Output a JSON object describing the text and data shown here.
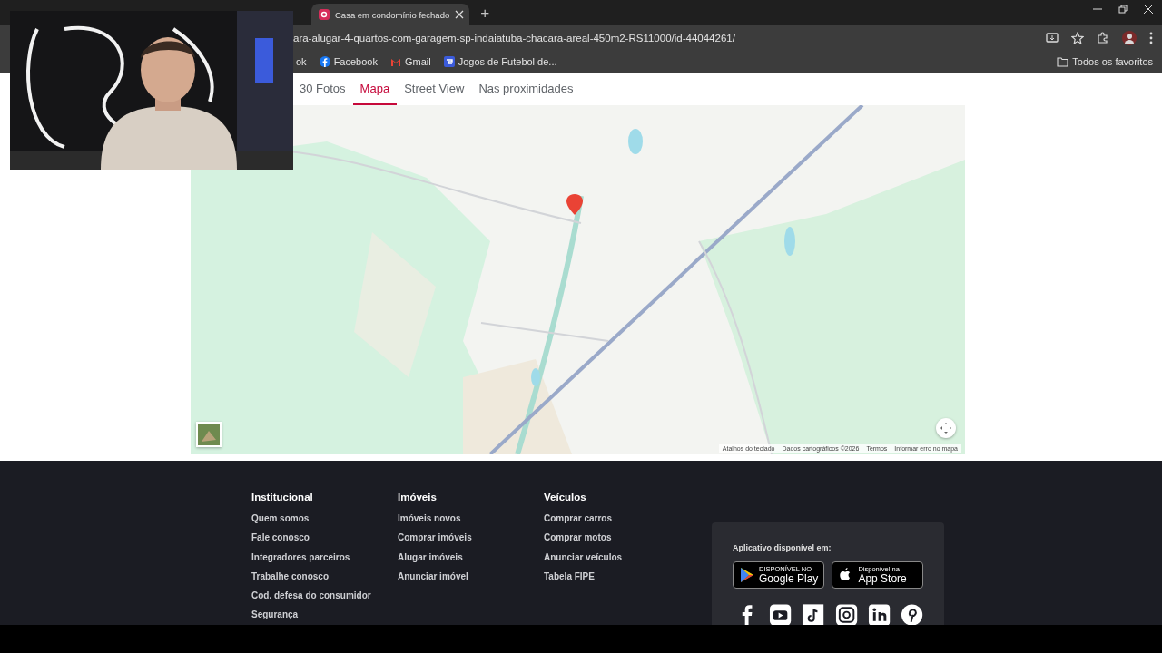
{
  "browser": {
    "tabs": [
      {
        "title": "Casa em condomínio fechado",
        "selected": true
      }
    ],
    "new_tab": "+",
    "address": "ara-alugar-4-quartos-com-garagem-sp-indaiatuba-chacara-areal-450m2-RS11000/id-44044261/",
    "bookmarks": [
      {
        "label": "ok",
        "kind": "cut"
      },
      {
        "label": "Facebook",
        "kind": "facebook"
      },
      {
        "label": "Gmail",
        "kind": "gmail"
      },
      {
        "label": "Jogos de Futebol de...",
        "kind": "game"
      }
    ],
    "all_bookmarks": "Todos os favoritos"
  },
  "listing_tabs": [
    {
      "label": "30 Fotos",
      "selected": false
    },
    {
      "label": "Mapa",
      "selected": true
    },
    {
      "label": "Street View",
      "selected": false
    },
    {
      "label": "Nas proximidades",
      "selected": false
    }
  ],
  "map": {
    "kind": "picture",
    "attribution": [
      "Atalhos do teclado",
      "Dados cartográficos ©2026",
      "Termos",
      "Informar erro no mapa"
    ]
  },
  "footer": {
    "columns": [
      {
        "title": "Institucional",
        "links": [
          "Quem somos",
          "Fale conosco",
          "Integradores parceiros",
          "Trabalhe conosco",
          "Cod. defesa do consumidor",
          "Segurança"
        ]
      },
      {
        "title": "Imóveis",
        "links": [
          "Imóveis novos",
          "Comprar imóveis",
          "Alugar imóveis",
          "Anunciar imóvel"
        ]
      },
      {
        "title": "Veículos",
        "links": [
          "Comprar carros",
          "Comprar motos",
          "Anunciar veículos",
          "Tabela FIPE"
        ]
      }
    ],
    "app": {
      "label": "Aplicativo disponível em:",
      "stores": [
        {
          "kind": "google",
          "small": "DISPONÍVEL NO",
          "big": "Google Play"
        },
        {
          "kind": "apple",
          "small": "Disponível na",
          "big": "App Store"
        }
      ],
      "social": [
        {
          "kind": "facebook"
        },
        {
          "kind": "youtube"
        },
        {
          "kind": "tiktok"
        },
        {
          "kind": "instagram"
        },
        {
          "kind": "linkedin"
        },
        {
          "kind": "pinterest"
        }
      ]
    }
  }
}
